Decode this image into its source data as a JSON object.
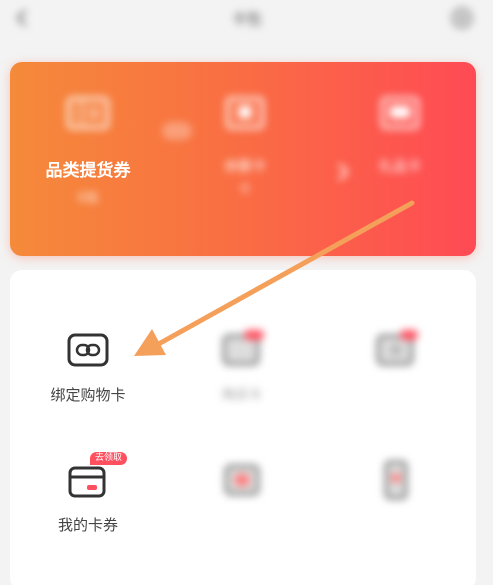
{
  "header": {
    "title": "卡包",
    "back_icon": "back-icon",
    "settings_icon": "settings-icon"
  },
  "card": {
    "gradient": [
      "#f58a3a",
      "#ff4a55"
    ],
    "items": [
      {
        "icon": "coupon-icon",
        "label": "品类提货券",
        "count": "0张"
      },
      {
        "icon": "card-icon",
        "label": "余额卡",
        "count": "0"
      },
      {
        "icon": "gift-icon",
        "label": "礼品卡",
        "count": ""
      }
    ]
  },
  "services": [
    {
      "icon": "link-icon",
      "label": "绑定购物卡",
      "badge": ""
    },
    {
      "icon": "buy-card-icon",
      "label": "购买卡",
      "badge": ""
    },
    {
      "icon": "redeem-icon",
      "label": "",
      "badge": ""
    },
    {
      "icon": "my-card-icon",
      "label": "我的卡券",
      "badge": "去领取"
    },
    {
      "icon": "card-icon",
      "label": "",
      "badge": ""
    },
    {
      "icon": "phone-icon",
      "label": "",
      "badge": ""
    }
  ],
  "colors": {
    "accent": "#ff5060",
    "arrow": "#f5a05a"
  }
}
